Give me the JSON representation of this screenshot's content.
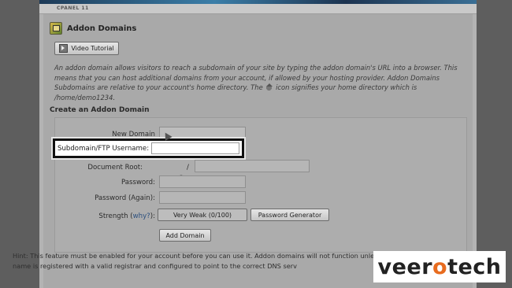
{
  "brand": {
    "strip_text": "CPANEL 11"
  },
  "page": {
    "title": "Addon Domains",
    "video_button": "Video Tutorial",
    "description_1": "An addon domain allows visitors to reach a subdomain of your site by typing the addon domain's URL into a browser. This means that you can host additional domains from your account, if allowed by your hosting provider. Addon Domains Subdomains are relative to your account's home directory. The",
    "description_2": "icon signifies your home directory which is /home/demo1234."
  },
  "form": {
    "section_title": "Create an Addon Domain",
    "new_domain_label": "New Domain Name:",
    "subdomain_label": "Subdomain/FTP Username:",
    "document_root_label": "Document Root:",
    "document_root_prefix": "/",
    "password_label": "Password:",
    "password_again_label": "Password (Again):",
    "strength_label": "Strength (",
    "strength_why": "why?",
    "strength_label_end": "):",
    "strength_value": "Very Weak (0/100)",
    "password_generator": "Password Generator",
    "add_domain": "Add Domain"
  },
  "hint": {
    "text": "Hint: This feature must be enabled for your account before you can use it. Addon domains will not function unless the domain name is registered with a valid registrar and configured to point to the correct DNS serv"
  },
  "logo": {
    "part1": "veer",
    "accent": "o",
    "part2": "tech"
  },
  "colors": {
    "logo_accent": "#e86c1f",
    "link": "#2b4f7e",
    "highlight_border": "#111111"
  }
}
